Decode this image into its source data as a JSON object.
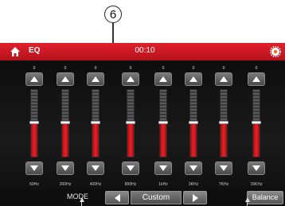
{
  "callout": {
    "number": "6"
  },
  "header": {
    "title": "EQ",
    "time": "00:10",
    "home_icon": "home-icon",
    "settings_icon": "settings-icon"
  },
  "bands": [
    {
      "value": "0",
      "freq": "50Hz",
      "level": 0.5
    },
    {
      "value": "0",
      "freq": "200Hz",
      "level": 0.5
    },
    {
      "value": "0",
      "freq": "400Hz",
      "level": 0.5
    },
    {
      "value": "0",
      "freq": "800Hz",
      "level": 0.5
    },
    {
      "value": "0",
      "freq": "1kHz",
      "level": 0.5
    },
    {
      "value": "0",
      "freq": "3KHz",
      "level": 0.5
    },
    {
      "value": "0",
      "freq": "7KHz",
      "level": 0.5
    },
    {
      "value": "0",
      "freq": "15KHz",
      "level": 0.5
    }
  ],
  "bottom": {
    "mode_label": "MODE",
    "preset": "Custom",
    "balance_label": "Balance"
  },
  "colors": {
    "accent": "#d41a24",
    "fill": "#e8232a",
    "background": "#111111"
  }
}
